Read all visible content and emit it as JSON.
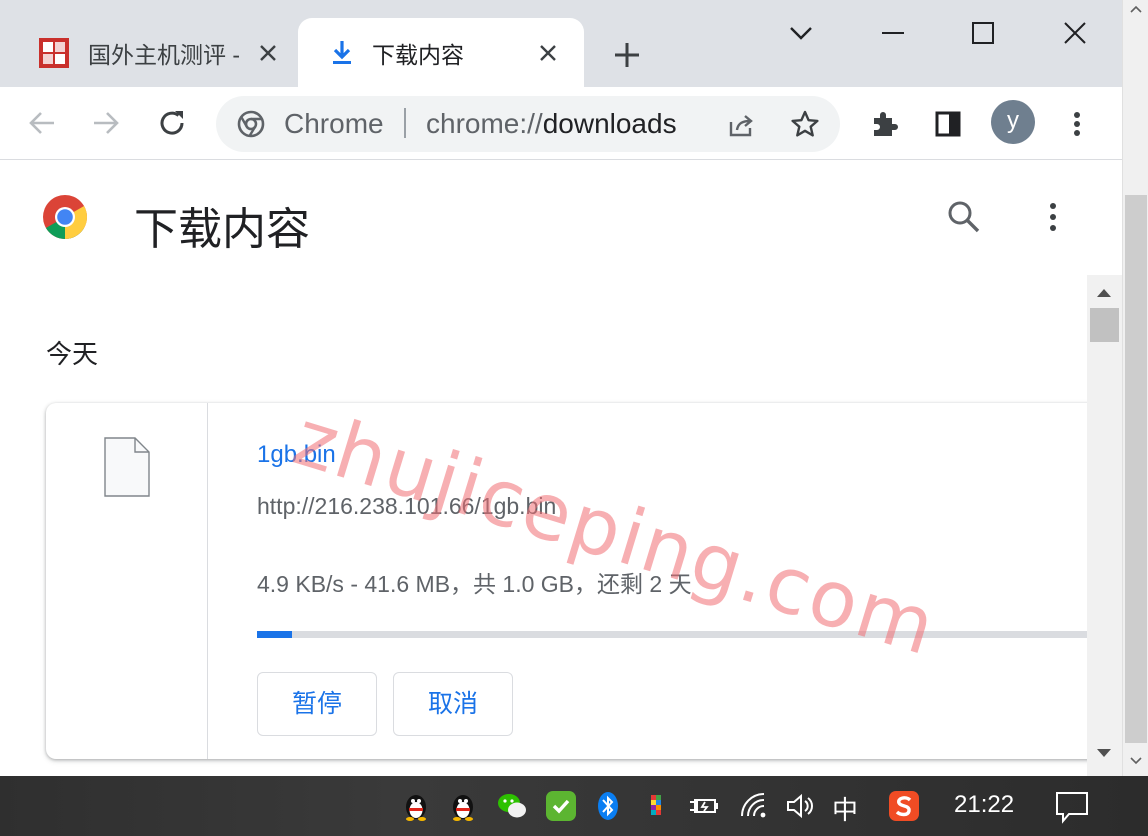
{
  "tabs": [
    {
      "title": "国外主机测评 -",
      "favicon": "zhujiceping-favicon",
      "active": false
    },
    {
      "title": "下载内容",
      "favicon": "download-icon",
      "active": true
    }
  ],
  "omnibox": {
    "chip": "Chrome",
    "scheme": "chrome://",
    "host": "downloads"
  },
  "profile": {
    "initial": "y"
  },
  "downloads": {
    "page_title": "下载内容",
    "section_date": "今天",
    "item": {
      "file_name": "1gb.bin",
      "url": "http://216.238.101.66/1gb.bin",
      "status": "4.9 KB/s - 41.6 MB，共 1.0 GB，还剩 2 天",
      "progress": 0.041,
      "pause_label": "暂停",
      "cancel_label": "取消"
    }
  },
  "watermark": "zhujiceping.com",
  "taskbar": {
    "ime": "中",
    "clock": "21:22"
  },
  "colors": {
    "accent": "#1a73e8",
    "tabstrip": "#dee1e6",
    "watermark": "#f06e73"
  }
}
